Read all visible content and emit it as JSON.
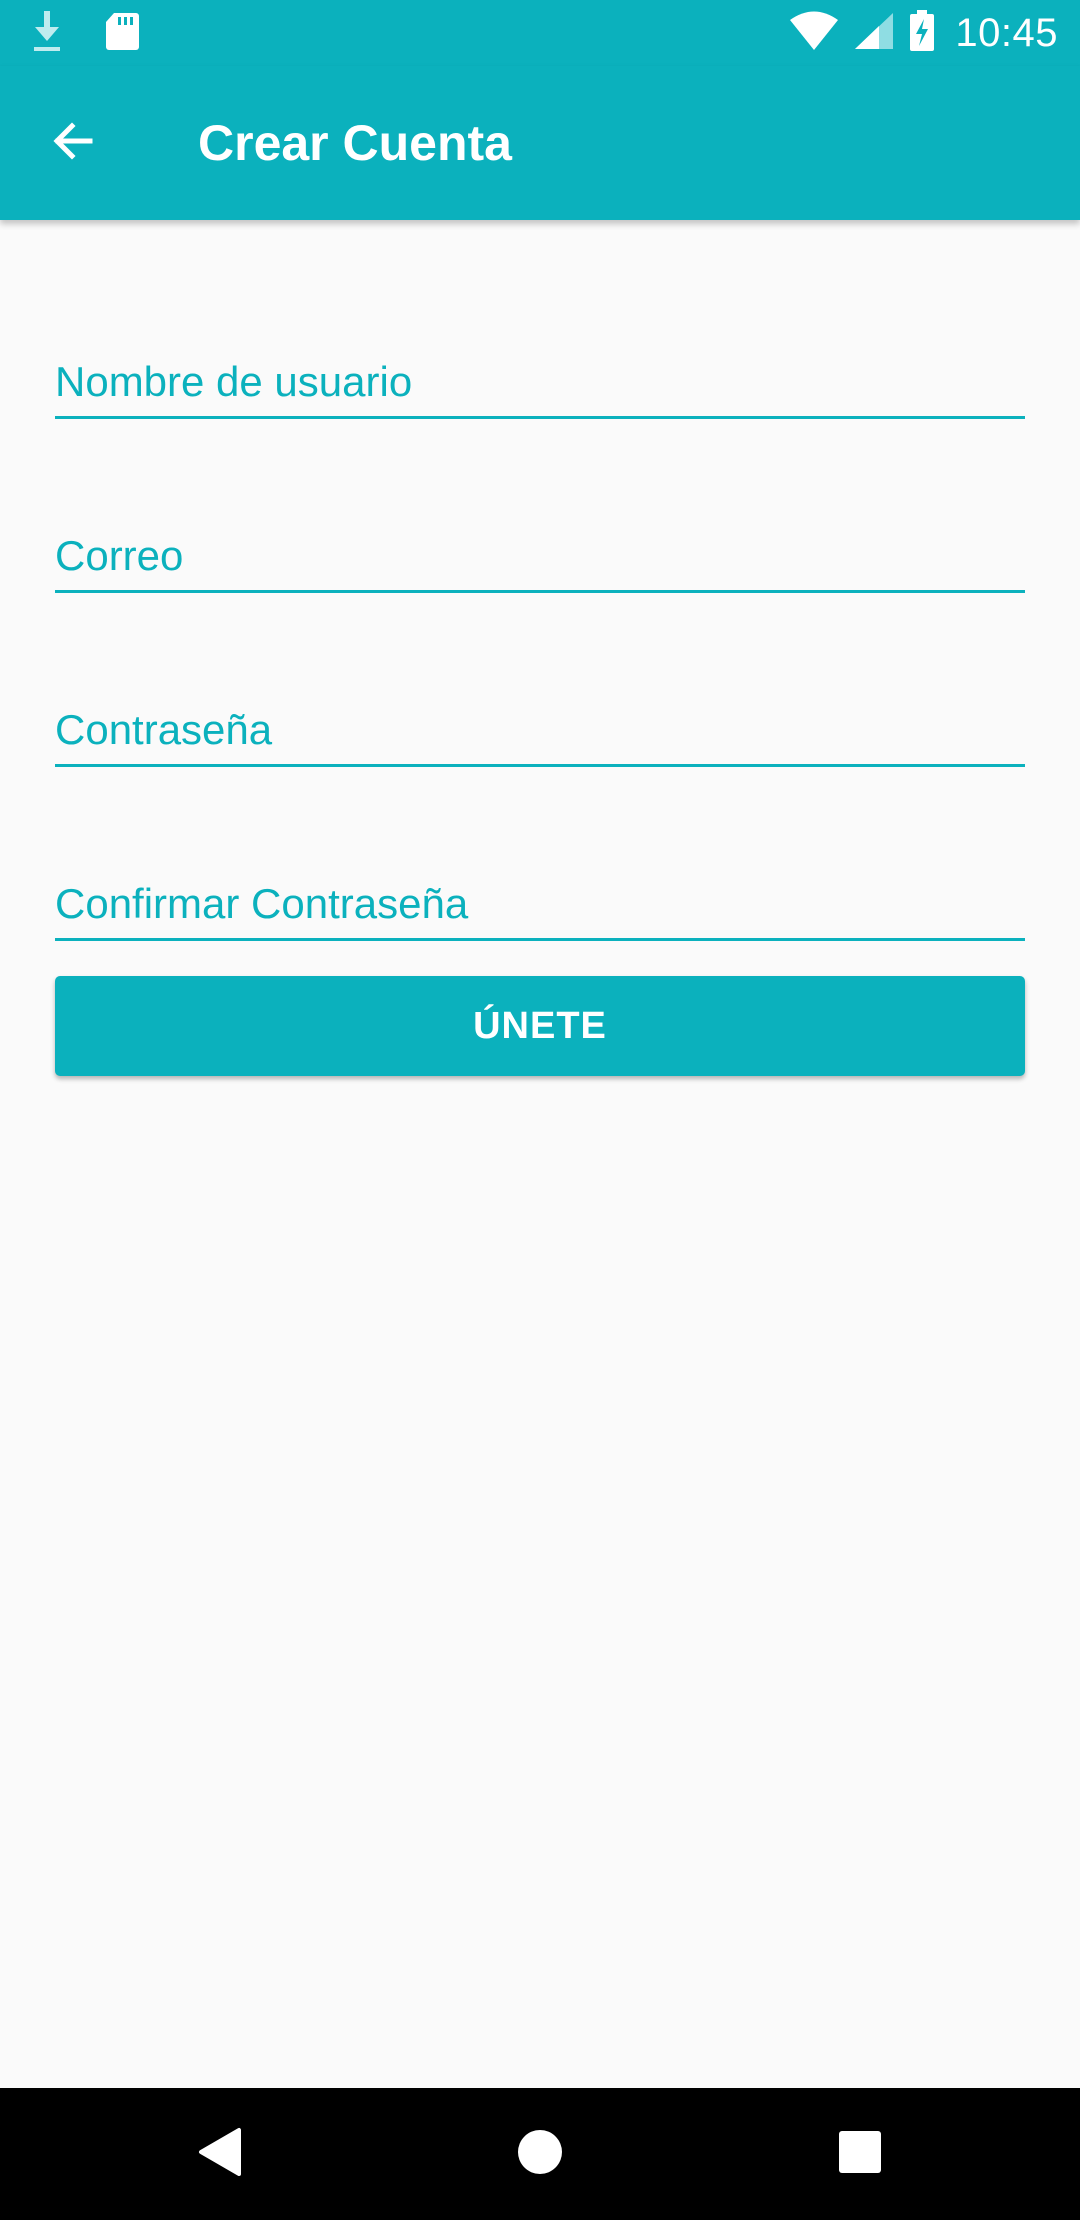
{
  "status_bar": {
    "time": "10:45",
    "left_icons": [
      "download-icon",
      "sd-card-icon"
    ],
    "right_icons": [
      "wifi-icon",
      "signal-icon",
      "battery-charging-icon"
    ]
  },
  "app_bar": {
    "back_icon": "arrow-back-icon",
    "title": "Crear Cuenta"
  },
  "form": {
    "username_placeholder": "Nombre de usuario",
    "email_placeholder": "Correo",
    "password_placeholder": "Contraseña",
    "confirm_password_placeholder": "Confirmar Contraseña",
    "join_label": "ÚNETE"
  },
  "nav_bar": {
    "icons": [
      "back-triangle-icon",
      "home-circle-icon",
      "recents-square-icon"
    ]
  },
  "colors": {
    "accent": "#0bb1bd",
    "background": "#fafafa",
    "on_accent": "#ffffff",
    "nav_background": "#000000"
  }
}
